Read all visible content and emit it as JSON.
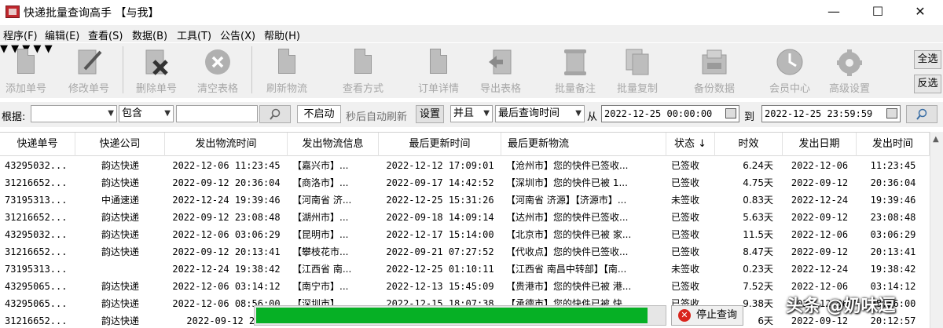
{
  "window": {
    "title": "快递批量查询高手 【与我】"
  },
  "window_controls": {
    "min": "—",
    "max": "☐",
    "close": "✕"
  },
  "menu": [
    "程序(F)",
    "编辑(E)",
    "查看(S)",
    "数据(B)",
    "工具(T)",
    "公告(X)",
    "帮助(H)"
  ],
  "toolbar": {
    "items": [
      "添加单号",
      "修改单号",
      "删除单号",
      "清空表格",
      "刷新物流",
      "查看方式",
      "订单详情",
      "导出表格",
      "批量备注",
      "批量复制",
      "备份数据",
      "会员中心",
      "高级设置"
    ],
    "side": [
      "全选",
      "反选"
    ]
  },
  "filter": {
    "basis_label": "根据:",
    "basis_value": "",
    "match_value": "包含",
    "keyword_value": "",
    "auto_button": "不启动",
    "auto_hint": "秒后自动刷新",
    "settings_button": "设置",
    "logic_value": "并且",
    "time_field_value": "最后查询时间",
    "from_label": "从",
    "from_value": "2022-12-25 00:00:00",
    "to_label": "到",
    "to_value": "2022-12-25 23:59:59"
  },
  "table": {
    "columns": [
      "快递单号",
      "快递公司",
      "发出物流时间",
      "发出物流信息",
      "最后更新时间",
      "最后更新物流",
      "状态 ↓",
      "时效",
      "发出日期",
      "发出时间"
    ],
    "rows": [
      [
        "43295032...",
        "韵达快递",
        "2022-12-06 11:23:45",
        "【嘉兴市】...",
        "2022-12-12 17:09:01",
        "【沧州市】您的快件已签收...",
        "已签收",
        "6.24天",
        "2022-12-06",
        "11:23:45"
      ],
      [
        "31216652...",
        "韵达快递",
        "2022-09-12 20:36:04",
        "【商洛市】...",
        "2022-09-17 14:42:52",
        "【深圳市】您的快件已被 1...",
        "已签收",
        "4.75天",
        "2022-09-12",
        "20:36:04"
      ],
      [
        "73195313...",
        "中通速递",
        "2022-12-24 19:39:46",
        "【河南省 济...",
        "2022-12-25 15:31:26",
        "【河南省 济源】【济源市】...",
        "未签收",
        "0.83天",
        "2022-12-24",
        "19:39:46"
      ],
      [
        "31216652...",
        "韵达快递",
        "2022-09-12 23:08:48",
        "【湖州市】...",
        "2022-09-18 14:09:14",
        "【达州市】您的快件已签收...",
        "已签收",
        "5.63天",
        "2022-09-12",
        "23:08:48"
      ],
      [
        "43295032...",
        "韵达快递",
        "2022-12-06 03:06:29",
        "【昆明市】...",
        "2022-12-17 15:14:00",
        "【北京市】您的快件已被 家...",
        "已签收",
        "11.5天",
        "2022-12-06",
        "03:06:29"
      ],
      [
        "31216652...",
        "韵达快递",
        "2022-09-12 20:13:41",
        "【攀枝花市...",
        "2022-09-21 07:27:52",
        "【代收点】您的快件已签收...",
        "已签收",
        "8.47天",
        "2022-09-12",
        "20:13:41"
      ],
      [
        "73195313...",
        "",
        "2022-12-24 19:38:42",
        "【江西省 南...",
        "2022-12-25 01:10:11",
        "【江西省 南昌中转部】【南...",
        "未签收",
        "0.23天",
        "2022-12-24",
        "19:38:42"
      ],
      [
        "43295065...",
        "韵达快递",
        "2022-12-06 03:14:12",
        "【南宁市】...",
        "2022-12-13 15:45:09",
        "【贵港市】您的快件已被 港...",
        "已签收",
        "7.52天",
        "2022-12-06",
        "03:14:12"
      ],
      [
        "43295065...",
        "韵达快递",
        "2022-12-06 08:56:00",
        "【深圳市】...",
        "2022-12-15 18:07:38",
        "【承德市】您的快件已被 快...",
        "已签收",
        "9.38天",
        "2022-12-06",
        "08:56:00"
      ],
      [
        "31216652...",
        "韵达快递",
        "2022-09-12 20:",
        "",
        "",
        "",
        "",
        "6天",
        "2022-09-12",
        "20:12:57"
      ]
    ]
  },
  "progress": {
    "value": 0.96,
    "color": "#06b025"
  },
  "stop_button": "停止查询",
  "watermark": "头条 @奶味逗"
}
